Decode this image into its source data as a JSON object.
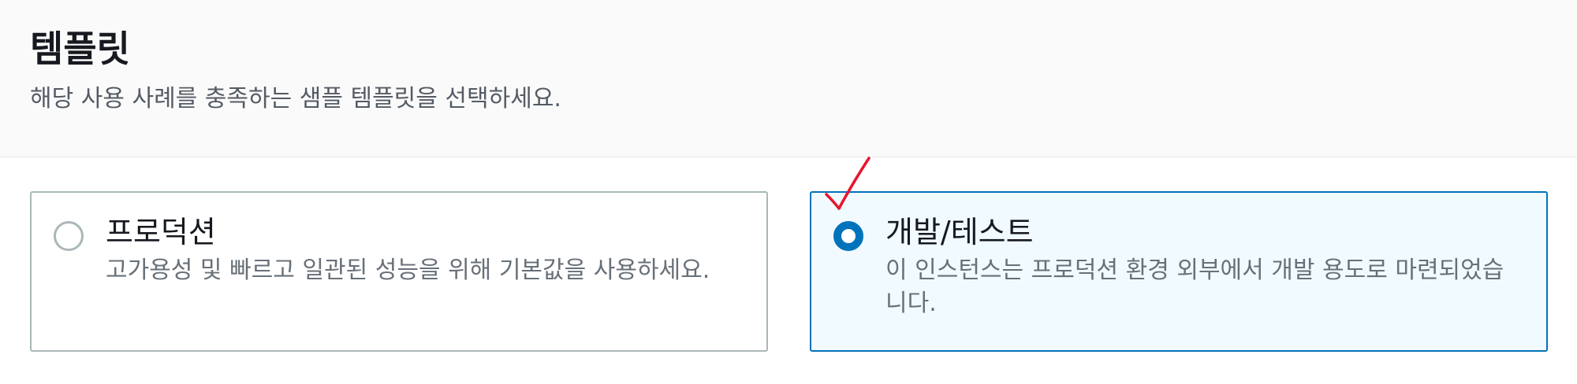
{
  "section": {
    "title": "템플릿",
    "description": "해당 사용 사례를 충족하는 샘플 템플릿을 선택하세요."
  },
  "templates": [
    {
      "label": "프로덕션",
      "description": "고가용성 및 빠르고 일관된 성능을 위해 기본값을 사용하세요.",
      "selected": false
    },
    {
      "label": "개발/테스트",
      "description": "이 인스턴스는 프로덕션 환경 외부에서 개발 용도로 마련되었습니다.",
      "selected": true
    }
  ],
  "colors": {
    "accent": "#0073bb",
    "selected_bg": "#f1faff",
    "annotation": "#e8142c"
  }
}
